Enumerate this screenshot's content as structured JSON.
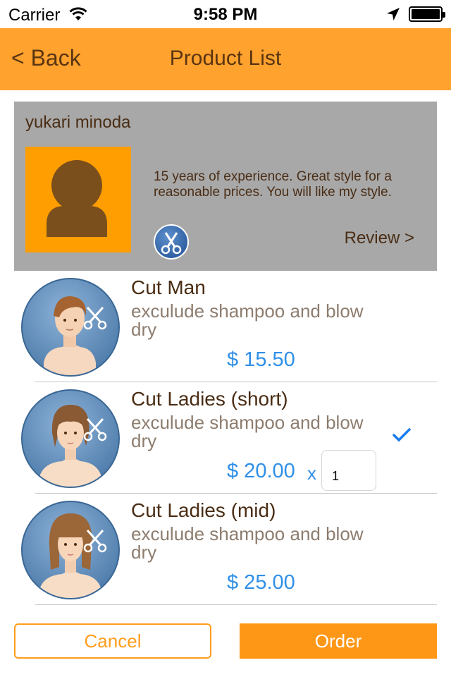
{
  "status_bar": {
    "carrier": "Carrier",
    "time": "9:58 PM",
    "icons": [
      "wifi-icon",
      "location-arrow-icon",
      "battery-icon"
    ]
  },
  "nav": {
    "back_label": "< Back",
    "title": "Product List"
  },
  "profile": {
    "name": "yukari minoda",
    "description": "15 years of experience. Great style for a reasonable prices.  You will like my style.",
    "review_label": "Review >",
    "avatar_icon": "person-silhouette-icon",
    "badge_icon": "scissors-icon"
  },
  "products": [
    {
      "title": "Cut Man",
      "subtitle": "exculude shampoo and blow dry",
      "price": "$ 15.50",
      "selected": false
    },
    {
      "title": "Cut Ladies (short)",
      "subtitle": "exculude shampoo and blow dry",
      "price": "$ 20.00",
      "qty_prefix": "x",
      "quantity": "1",
      "selected": true
    },
    {
      "title": "Cut Ladies (mid)",
      "subtitle": "exculude shampoo and blow dry",
      "price": "$ 25.00",
      "selected": false
    }
  ],
  "footer": {
    "cancel_label": "Cancel",
    "order_label": "Order"
  },
  "colors": {
    "nav_background": "#ffa22e",
    "accent_orange": "#ff9716",
    "price_blue": "#2f8fe8",
    "text_brown": "#4a2d14",
    "profile_gray": "#a8a8a8"
  }
}
